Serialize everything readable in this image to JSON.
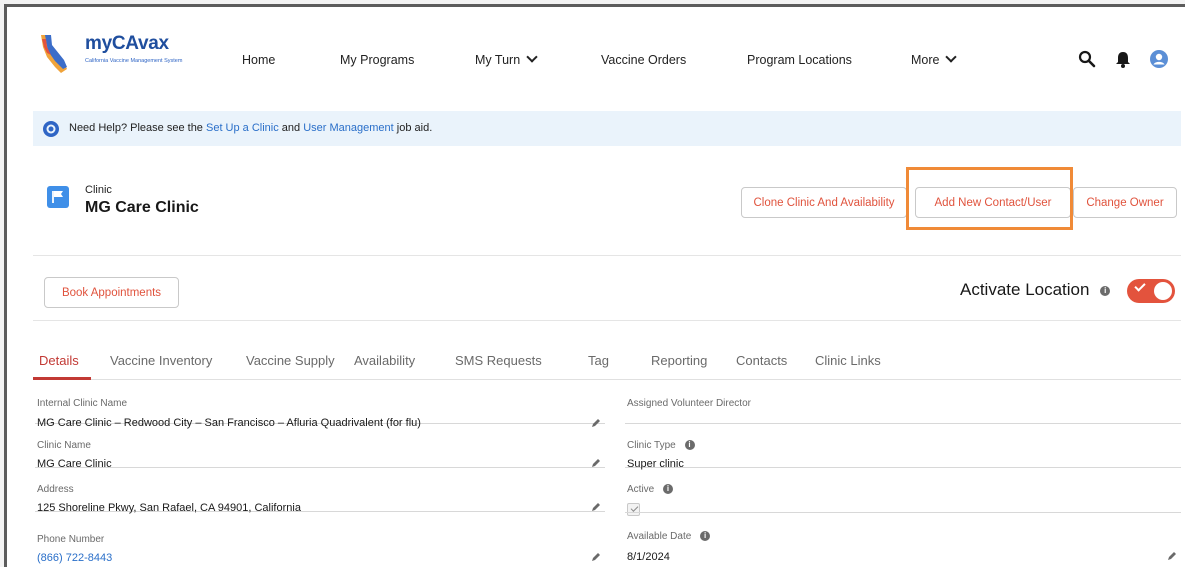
{
  "app": {
    "logo_text": "myCAvax",
    "logo_subtitle": "California Vaccine Management System"
  },
  "nav": {
    "items": [
      {
        "label": "Home"
      },
      {
        "label": "My Programs"
      },
      {
        "label": "My Turn"
      },
      {
        "label": "Vaccine Orders"
      },
      {
        "label": "Program Locations"
      },
      {
        "label": "More"
      }
    ],
    "icons": [
      "search-icon",
      "bell-icon",
      "user-avatar-icon"
    ]
  },
  "help": {
    "prefix": "Need Help? Please see the ",
    "link1": "Set Up a Clinic",
    "and": " and ",
    "link2": "User Management",
    "suffix": " job aid."
  },
  "record": {
    "type_label": "Clinic",
    "title": "MG Care Clinic",
    "buttons": {
      "clone": "Clone Clinic And Availability",
      "add_contact": "Add New Contact/User",
      "change_owner": "Change Owner"
    }
  },
  "actions": {
    "book": "Book Appointments",
    "activate_label": "Activate Location",
    "activate_on": true
  },
  "tabs": [
    {
      "label": "Details",
      "active": true
    },
    {
      "label": "Vaccine Inventory"
    },
    {
      "label": "Vaccine Supply"
    },
    {
      "label": "Availability"
    },
    {
      "label": "SMS Requests"
    },
    {
      "label": "Tag"
    },
    {
      "label": "Reporting"
    },
    {
      "label": "Contacts"
    },
    {
      "label": "Clinic Links"
    }
  ],
  "fields": {
    "left": [
      {
        "label": "Internal Clinic Name",
        "value": "MG Care Clinic – Redwood City – San Francisco – Afluria Quadrivalent (for flu)"
      },
      {
        "label": "Clinic Name",
        "value": "MG Care Clinic"
      },
      {
        "label": "Address",
        "value": "125 Shoreline Pkwy, San Rafael, CA 94901, California"
      },
      {
        "label": "Phone Number",
        "value": "(866) 722-8443"
      }
    ],
    "right": [
      {
        "label": "Assigned Volunteer Director",
        "value": ""
      },
      {
        "label": "Clinic Type",
        "value": "Super clinic"
      },
      {
        "label": "Active",
        "checked": true
      },
      {
        "label": "Available Date",
        "value": "8/1/2024"
      }
    ]
  },
  "colors": {
    "brand_red": "#c23934",
    "accent_orange": "#f08a37",
    "link_blue": "#2a6fc9"
  }
}
